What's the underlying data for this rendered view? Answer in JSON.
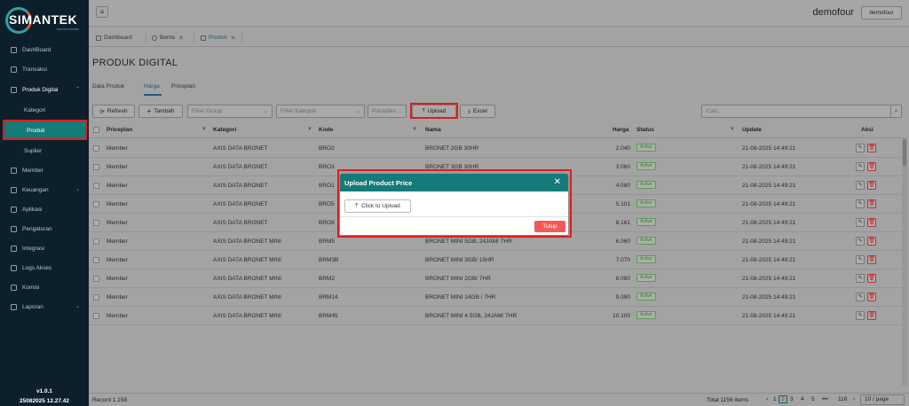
{
  "brand": {
    "name": "SIMANTEK",
    "tagline": "DIGITAL SYSTEM"
  },
  "sidebar": {
    "items": [
      {
        "label": "DashBoard",
        "icon": "dashboard-icon"
      },
      {
        "label": "Transaksi",
        "icon": "transaction-icon"
      },
      {
        "label": "Produk Digital",
        "icon": "product-icon",
        "expanded": true
      },
      {
        "label": "Kategori",
        "sub": true
      },
      {
        "label": "Produk",
        "sub": true,
        "active": true
      },
      {
        "label": "Suplier",
        "sub": true
      },
      {
        "label": "Member",
        "icon": "member-icon"
      },
      {
        "label": "Keuangan",
        "icon": "finance-icon",
        "has_children": true
      },
      {
        "label": "Aplikasi",
        "icon": "app-icon"
      },
      {
        "label": "Pengaturan",
        "icon": "settings-icon"
      },
      {
        "label": "Integrasi",
        "icon": "integration-icon"
      },
      {
        "label": "Logs Akses",
        "icon": "logs-icon"
      },
      {
        "label": "Komisi",
        "icon": "commission-icon"
      },
      {
        "label": "Laporan",
        "icon": "report-icon",
        "has_children": true
      }
    ],
    "version": "v1.0.1",
    "build": "25082025 12.27.42"
  },
  "topbar": {
    "user_name": "demofour",
    "user_button": "demofour"
  },
  "tabs": [
    {
      "label": "Dashboard",
      "closable": false
    },
    {
      "label": "Berita",
      "closable": true
    },
    {
      "label": "Produk",
      "closable": true,
      "active": true
    }
  ],
  "page": {
    "title": "PRODUK DIGITAL",
    "subtabs": [
      "Data Produk",
      "Harga",
      "Priceplan"
    ],
    "active_subtab": "Harga"
  },
  "toolbar": {
    "refresh": "Refresh",
    "add": "Tambah",
    "filter_group": "Filter Group",
    "filter_kategori": "Filter Kategori",
    "priceplan": "Priceplan",
    "upload": "Upload",
    "excel": "Excel",
    "search_placeholder": "Cari..."
  },
  "table": {
    "columns": [
      "Priceplan",
      "Kategori",
      "Kode",
      "Nama",
      "Harga",
      "Status",
      "Update",
      "Aksi"
    ],
    "rows": [
      [
        "Member",
        "AXIS DATA BRONET",
        "BRO2",
        "BRONET 2GB 30HR",
        "2.040",
        "Active",
        "21-08-2025 14:49:21"
      ],
      [
        "Member",
        "AXIS DATA BRONET",
        "BRO3",
        "BRONET 3GB 30HR",
        "3.060",
        "Active",
        "21-08-2025 14:49:21"
      ],
      [
        "Member",
        "AXIS DATA BRONET",
        "BRO1",
        "",
        "4.080",
        "Active",
        "21-08-2025 14:49:21"
      ],
      [
        "Member",
        "AXIS DATA BRONET",
        "BRO5",
        "",
        "5.101",
        "Active",
        "21-08-2025 14:49:21"
      ],
      [
        "Member",
        "AXIS DATA BRONET",
        "BRO8",
        "",
        "8.161",
        "Active",
        "21-08-2025 14:49:21"
      ],
      [
        "Member",
        "AXIS DATA BRONET MINI",
        "BRM5",
        "BRONET MINI 5GB, 24JAM/ 7HR",
        "6.060",
        "Active",
        "21-08-2025 14:49:21"
      ],
      [
        "Member",
        "AXIS DATA BRONET MINI",
        "BRM3B",
        "BRONET MINI 3GB/ 15HR",
        "7.070",
        "Active",
        "21-08-2025 14:49:21"
      ],
      [
        "Member",
        "AXIS DATA BRONET MINI",
        "BRM2",
        "BRONET MINI 2GB/ 7HR",
        "8.080",
        "Active",
        "21-08-2025 14:49:21"
      ],
      [
        "Member",
        "AXIS DATA BRONET MINI",
        "BRM14",
        "BRONET MINI 14GB / 7HR",
        "9.090",
        "Active",
        "21-08-2025 14:49:21"
      ],
      [
        "Member",
        "AXIS DATA BRONET MINI",
        "BRM45",
        "BRONET MINI 4.5GB, 24JAM/ 7HR",
        "10.100",
        "Active",
        "21-08-2025 14:49:21"
      ]
    ]
  },
  "footer": {
    "record": "Record 1.158",
    "total": "Total 1156 items",
    "pages": [
      "1",
      "2",
      "3",
      "4",
      "5",
      "•••",
      "116"
    ],
    "current_page": "2",
    "per_page": "10 / page"
  },
  "modal": {
    "title": "Upload Product Price",
    "upload_button": "Click to Upload",
    "close_button": "Tutup"
  },
  "colors": {
    "accent": "#157a78",
    "danger": "#f25a5a",
    "highlight": "#e01b1b"
  }
}
